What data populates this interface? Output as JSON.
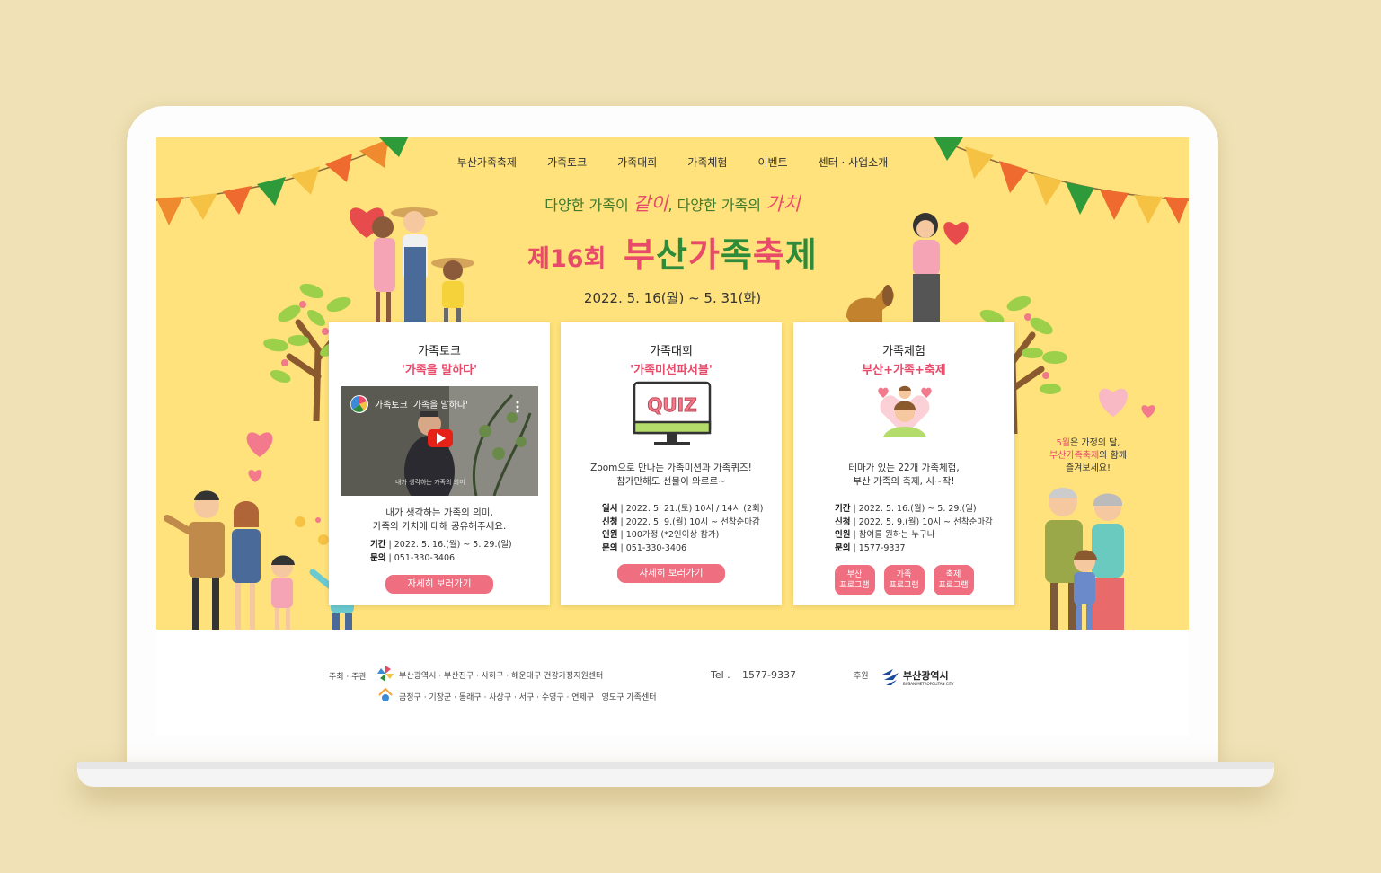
{
  "nav": [
    "부산가족축제",
    "가족토크",
    "가족대회",
    "가족체험",
    "이벤트",
    "센터 · 사업소개"
  ],
  "hero": {
    "tagline_1": "다양한 가족이 ",
    "tagline_hl1": "같이",
    "tagline_2": ", 다양한 가족의 ",
    "tagline_hl2": "가치",
    "edition": "제16회",
    "title_parts": [
      "부",
      "산",
      "가",
      "족",
      "축",
      "제"
    ],
    "date": "2022. 5. 16(월) ~ 5. 31(화)"
  },
  "cards": [
    {
      "title": "가족토크",
      "subtitle": "'가족을 말하다'",
      "video_title": "가족토크 '가족을 말하다'",
      "video_caption": "내가 생각하는 가족의 의미",
      "desc_1": "내가 생각하는 가족의 의미,",
      "desc_2": "가족의 가치에 대해 공유해주세요.",
      "info": [
        {
          "k": "기간",
          "v": "2022. 5. 16.(월) ~ 5. 29.(일)"
        },
        {
          "k": "문의",
          "v": "051-330-3406"
        }
      ],
      "button": "자세히 보러가기"
    },
    {
      "title": "가족대회",
      "subtitle": "'가족미션파서블'",
      "quiz": "QUIZ",
      "desc_1": "Zoom으로 만나는 가족미션과 가족퀴즈!",
      "desc_2": "참가만해도 선물이 와르르~",
      "info": [
        {
          "k": "일시",
          "v": "2022. 5. 21.(토) 10시 / 14시 (2회)"
        },
        {
          "k": "신청",
          "v": "2022. 5. 9.(월) 10시 ~ 선착순마감"
        },
        {
          "k": "인원",
          "v": "100가정 (*2인이상 참가)"
        },
        {
          "k": "문의",
          "v": "051-330-3406"
        }
      ],
      "button": "자세히 보러가기"
    },
    {
      "title": "가족체험",
      "subtitle": "부산+가족+축제",
      "desc_1": "테마가 있는 22개 가족체험,",
      "desc_2": "부산 가족의 축제, 시~작!",
      "info": [
        {
          "k": "기간",
          "v": "2022. 5. 16.(월) ~ 5. 29.(일)"
        },
        {
          "k": "신청",
          "v": "2022. 5. 9.(월) 10시 ~ 선착순마감"
        },
        {
          "k": "인원",
          "v": "참여를 원하는 누구나"
        },
        {
          "k": "문의",
          "v": "1577-9337"
        }
      ],
      "programs": [
        {
          "l1": "부산",
          "l2": "프로그램"
        },
        {
          "l1": "가족",
          "l2": "프로그램"
        },
        {
          "l1": "축제",
          "l2": "프로그램"
        }
      ]
    }
  ],
  "side_text": {
    "l1_hl": "5월",
    "l1": "은 가정의 달,",
    "l2_hl": "부산가족축제",
    "l2": "와 함께",
    "l3": "즐겨보세요!"
  },
  "footer": {
    "host_label": "주최 · 주관",
    "host_1": "부산광역시 · 부산진구 · 사하구 · 해운대구 건강가정지원센터",
    "host_2": "금정구 · 기장군 · 동래구 · 사상구 · 서구 · 수영구 · 연제구 · 영도구 가족센터",
    "tel_label": "Tel .",
    "tel": "1577-9337",
    "sponsor_label": "후원",
    "sponsor": "부산광역시",
    "sponsor_en": "BUSAN METROPOLITAN CITY"
  },
  "colors": {
    "background": "#f0e2b6",
    "screen": "#ffe27b",
    "accent": "#e84b6a",
    "green": "#2e8b3a",
    "button": "#ef6f80"
  }
}
